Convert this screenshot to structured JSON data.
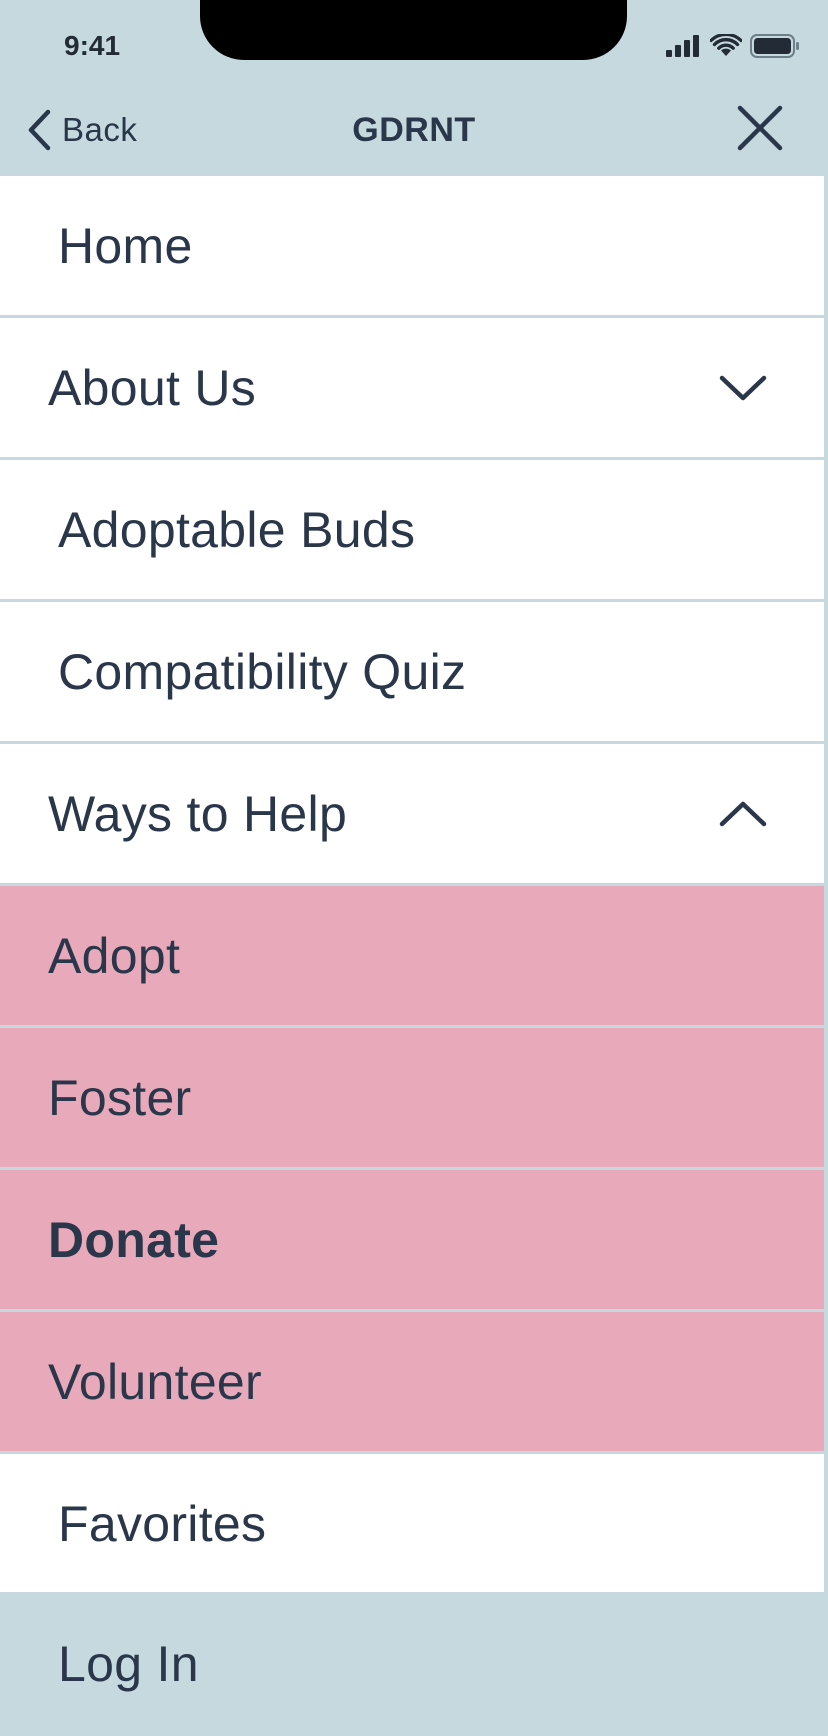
{
  "status_bar": {
    "time": "9:41",
    "icons": [
      "cellular-signal-icon",
      "wifi-icon",
      "battery-icon"
    ]
  },
  "nav": {
    "back_label": "Back",
    "title": "GDRNT",
    "close_icon": "close-icon"
  },
  "menu": {
    "home": "Home",
    "about": "About Us",
    "adoptable": "Adoptable Buds",
    "quiz": "Compatibility Quiz",
    "ways": "Ways to Help",
    "adopt": "Adopt",
    "foster": "Foster",
    "donate": "Donate",
    "volunteer": "Volunteer",
    "favorites": "Favorites"
  },
  "footer": {
    "login": "Log In"
  },
  "colors": {
    "header_bg": "#c5d9de",
    "submenu_bg": "#e8aaba",
    "text": "#2a3649",
    "item_bg": "#ffffff"
  }
}
